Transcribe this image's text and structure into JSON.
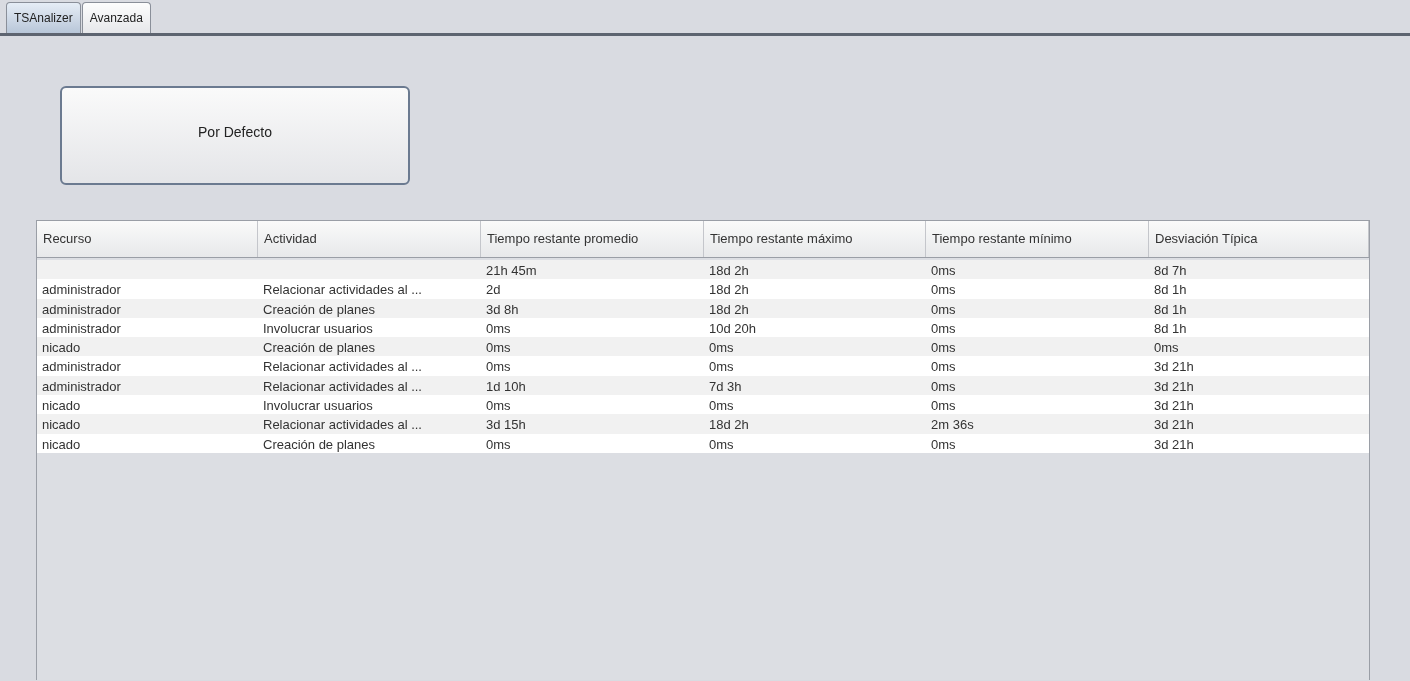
{
  "tabs": [
    {
      "label": "TSAnalizer",
      "selected": true
    },
    {
      "label": "Avanzada",
      "selected": false
    }
  ],
  "default_button": {
    "label": "Por Defecto"
  },
  "table": {
    "columns": [
      "Recurso",
      "Actividad",
      "Tiempo restante promedio",
      "Tiempo restante máximo",
      "Tiempo restante mínimo",
      "Desviación Típica"
    ],
    "rows": [
      [
        "",
        "",
        "21h 45m",
        "18d 2h",
        "0ms",
        "8d 7h"
      ],
      [
        "administrador",
        "Relacionar actividades al ...",
        "2d",
        "18d 2h",
        "0ms",
        "8d 1h"
      ],
      [
        "administrador",
        "Creación de planes",
        "3d 8h",
        "18d 2h",
        "0ms",
        "8d 1h"
      ],
      [
        "administrador",
        "Involucrar usuarios",
        "0ms",
        "10d 20h",
        "0ms",
        "8d 1h"
      ],
      [
        "nicado",
        "Creación de planes",
        "0ms",
        "0ms",
        "0ms",
        "0ms"
      ],
      [
        "administrador",
        "Relacionar actividades al ...",
        "0ms",
        "0ms",
        "0ms",
        "3d 21h"
      ],
      [
        "administrador",
        "Relacionar actividades al ...",
        "1d 10h",
        "7d 3h",
        "0ms",
        "3d 21h"
      ],
      [
        "nicado",
        "Involucrar usuarios",
        "0ms",
        "0ms",
        "0ms",
        "3d 21h"
      ],
      [
        "nicado",
        "Relacionar actividades al ...",
        "3d 15h",
        "18d 2h",
        "2m 36s",
        "3d 21h"
      ],
      [
        "nicado",
        "Creación de planes",
        "0ms",
        "0ms",
        "0ms",
        "3d 21h"
      ]
    ]
  }
}
